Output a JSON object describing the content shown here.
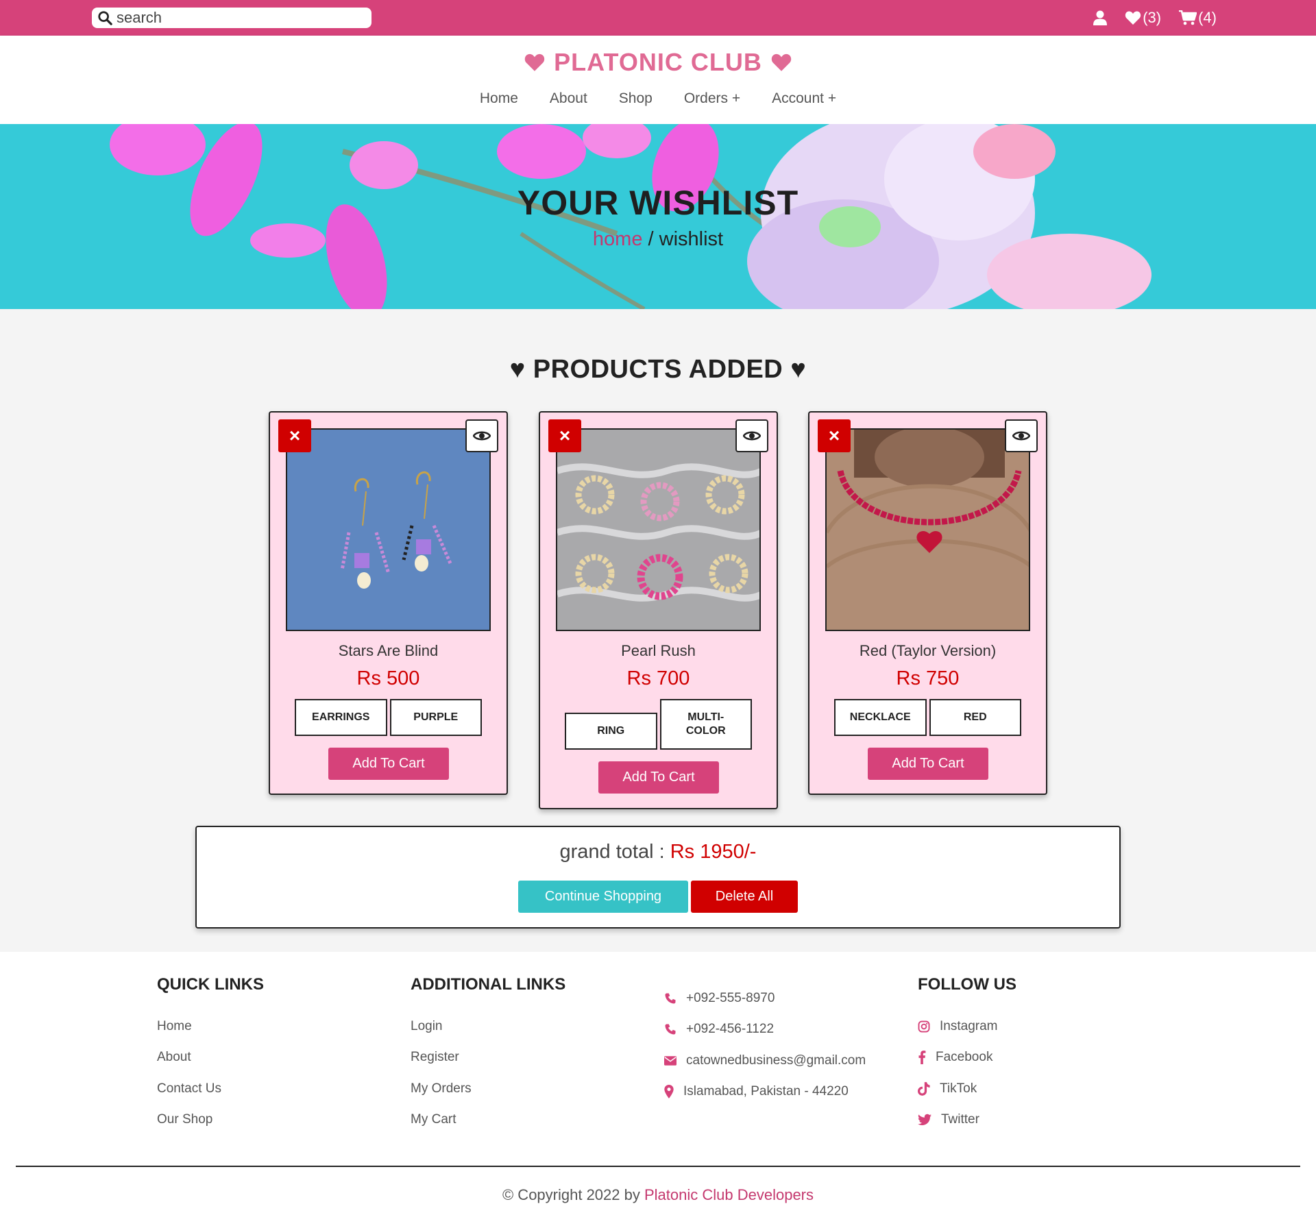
{
  "topbar": {
    "search_placeholder": "search",
    "wishlist_count": "(3)",
    "cart_count": "(4)"
  },
  "brand": {
    "name": "PLATONIC CLUB",
    "color": "#e06a94"
  },
  "nav": [
    "Home",
    "About",
    "Shop",
    "Orders +",
    "Account +"
  ],
  "hero": {
    "title": "YOUR WISHLIST",
    "breadcrumb_home": "home",
    "breadcrumb_sep": " / ",
    "breadcrumb_current": "wishlist"
  },
  "section": {
    "title": "♥ PRODUCTS ADDED ♥"
  },
  "products": [
    {
      "name": "Stars Are Blind",
      "price": "Rs 500",
      "tags": [
        "EARRINGS",
        "PURPLE"
      ],
      "add_label": "Add To Cart",
      "remove_label": "×"
    },
    {
      "name": "Pearl Rush",
      "price": "Rs 700",
      "tags": [
        "RING",
        "MULTI-\nCOLOR"
      ],
      "add_label": "Add To Cart",
      "remove_label": "×"
    },
    {
      "name": "Red (Taylor Version)",
      "price": "Rs 750",
      "tags": [
        "NECKLACE",
        "RED"
      ],
      "add_label": "Add To Cart",
      "remove_label": "×"
    }
  ],
  "total": {
    "label": "grand total : ",
    "amount": "Rs 1950/-",
    "continue_label": "Continue Shopping",
    "delete_all_label": "Delete All"
  },
  "footer": {
    "quick_links": {
      "title": "QUICK LINKS",
      "items": [
        "Home",
        "About",
        "Contact Us",
        "Our Shop"
      ]
    },
    "additional_links": {
      "title": "ADDITIONAL LINKS",
      "items": [
        "Login",
        "Register",
        "My Orders",
        "My Cart"
      ]
    },
    "contact": {
      "phone1": "+092-555-8970",
      "phone2": "+092-456-1122",
      "email": "catownedbusiness@gmail.com",
      "address": "Islamabad, Pakistan - 44220"
    },
    "follow": {
      "title": "FOLLOW US",
      "items": [
        "Instagram",
        "Facebook",
        "TikTok",
        "Twitter"
      ]
    },
    "copyright_prefix": "© Copyright 2022 by ",
    "copyright_name": "Platonic Club Developers"
  },
  "colors": {
    "accent": "#d6427a",
    "price": "#d00000",
    "teal": "#36c2c6",
    "card_bg": "#ffdbea"
  }
}
